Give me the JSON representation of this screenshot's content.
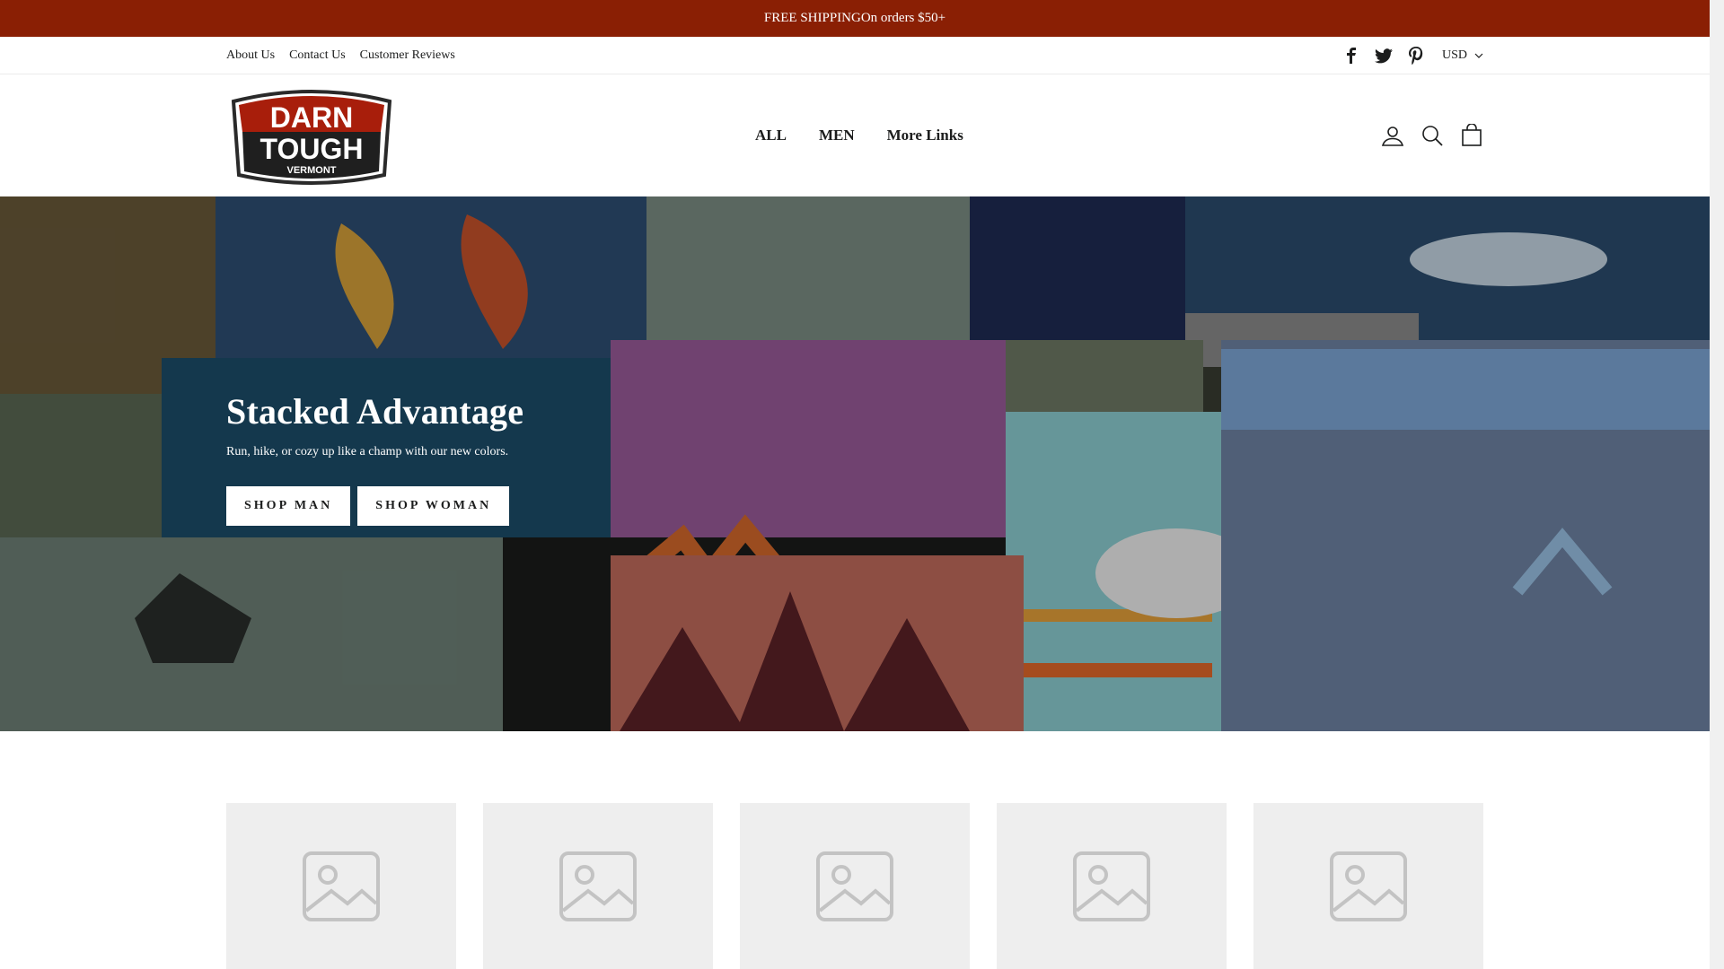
{
  "announcement": {
    "text": "FREE SHIPPINGOn orders $50+"
  },
  "utility_nav": {
    "links": [
      "About Us",
      "Contact Us",
      "Customer Reviews"
    ],
    "social": [
      "facebook-icon",
      "twitter-icon",
      "pinterest-icon"
    ],
    "currency": "USD"
  },
  "header": {
    "logo_text": {
      "line1": "DARN",
      "line2": "TOUGH",
      "line3": "VERMONT"
    },
    "nav": [
      "ALL",
      "MEN",
      "More Links"
    ],
    "icons": [
      "account-icon",
      "search-icon",
      "cart-icon"
    ]
  },
  "hero": {
    "title": "Stacked Advantage",
    "subtitle": "Run, hike, or cozy up like a champ with our new colors.",
    "button_primary": "SHOP MAN",
    "button_secondary": "SHOP WOMAN"
  },
  "collection_cards": 5,
  "colors": {
    "announcement_bg": "#8a1f04",
    "text": "#1c1d1d",
    "placeholder": "#eeeeee"
  }
}
